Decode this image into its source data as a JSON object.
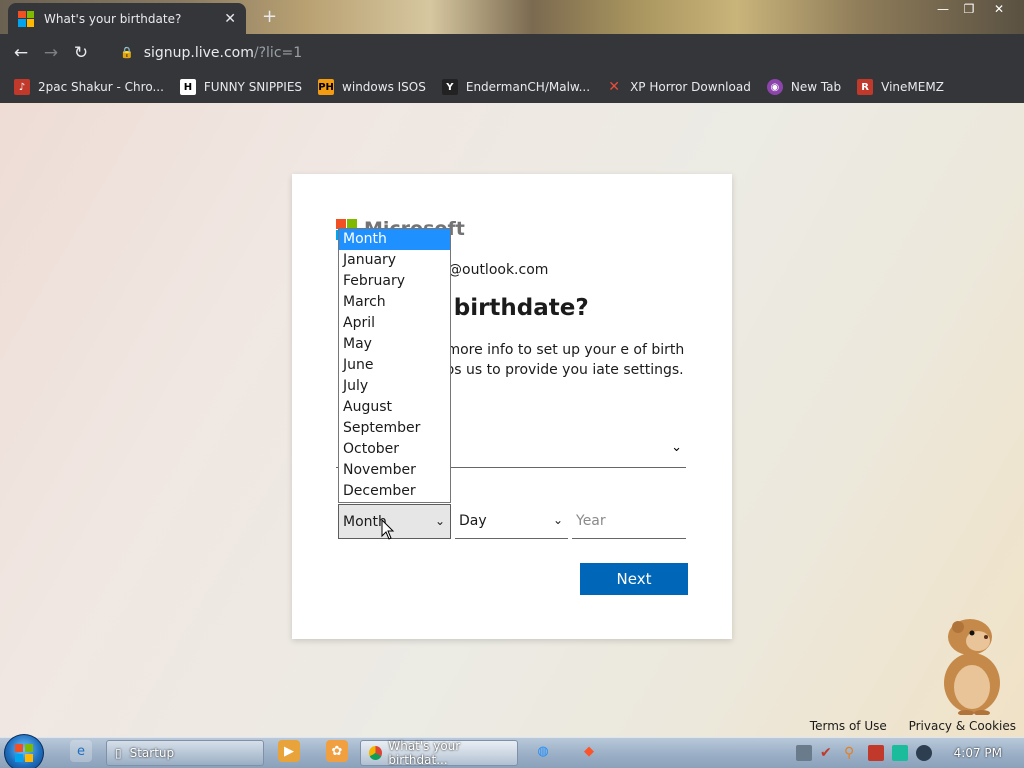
{
  "browser": {
    "tab_title": "What's your birthdate?",
    "tab_close": "✕",
    "new_tab": "+",
    "window_controls": [
      "—",
      "❐",
      "✕"
    ],
    "url_host": "signup.live.com",
    "url_path": "/?lic=1",
    "bookmarks": [
      {
        "label": "2pac Shakur - Chro...",
        "icon": "music-icon",
        "color": "#c0392b"
      },
      {
        "label": "FUNNY SNIPPIES",
        "icon": "h-logo-icon",
        "color": "#ffffff"
      },
      {
        "label": "windows ISOS",
        "icon": "ph-logo-icon",
        "color": "#f39c12"
      },
      {
        "label": "EndermanCH/Malw...",
        "icon": "y-logo-icon",
        "color": "#333333"
      },
      {
        "label": "XP Horror Download",
        "icon": "x-logo-icon",
        "color": "#e74c3c"
      },
      {
        "label": "New Tab",
        "icon": "globe-icon",
        "color": "#8e44ad"
      },
      {
        "label": "VineMEMZ",
        "icon": "r-logo-icon",
        "color": "#c0392b"
      }
    ]
  },
  "page": {
    "logo_text": "Microsoft",
    "email": "@outlook.com",
    "heading": "ur birthdate?",
    "description": "tle more info to set up your e of birth helps us to provide you iate settings.",
    "month_placeholder": "Month",
    "day_placeholder": "Day",
    "year_placeholder": "Year",
    "next_label": "Next",
    "month_options": [
      "Month",
      "January",
      "February",
      "March",
      "April",
      "May",
      "June",
      "July",
      "August",
      "September",
      "October",
      "November",
      "December"
    ],
    "selected_month_index": 0,
    "footer_terms": "Terms of Use",
    "footer_privacy": "Privacy & Cookies"
  },
  "taskbar": {
    "task1": "Startup",
    "task2": "What's your birthdat...",
    "clock": "4:07 PM"
  },
  "colors": {
    "accent": "#0067b8",
    "highlight": "#1e90ff"
  }
}
